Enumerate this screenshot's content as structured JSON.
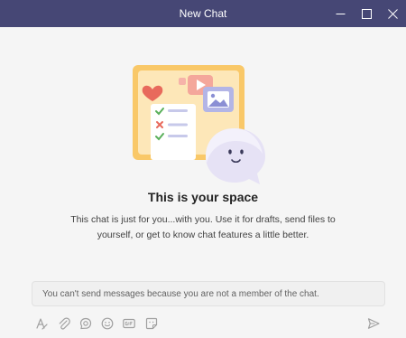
{
  "window": {
    "title": "New Chat"
  },
  "empty_state": {
    "title": "This is your space",
    "description": "This chat is just for you...with you. Use it for drafts, send files to yourself, or get to know chat features a little better.",
    "illustration": "space-illustration"
  },
  "compose": {
    "notice": "You can't send messages because you are not a member of the chat."
  },
  "toolbar": {
    "icons": [
      "format-icon",
      "attach-icon",
      "loop-icon",
      "emoji-icon",
      "gif-icon",
      "sticker-icon",
      "send-icon"
    ]
  },
  "colors": {
    "titlebar": "#464775",
    "background": "#f5f5f5",
    "icon_gray": "#9e9e9e"
  }
}
